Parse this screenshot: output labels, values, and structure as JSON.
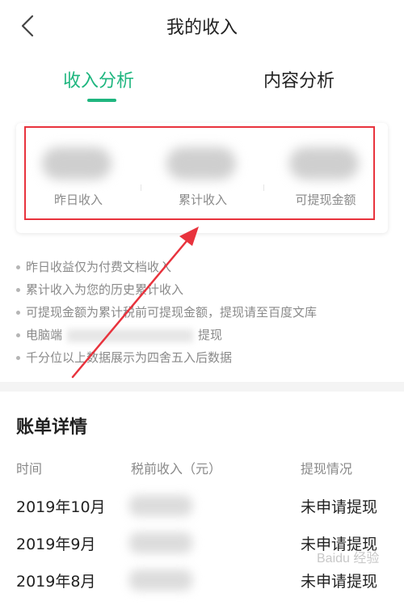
{
  "header": {
    "title": "我的收入"
  },
  "tabs": [
    {
      "label": "收入分析",
      "active": true
    },
    {
      "label": "内容分析",
      "active": false
    }
  ],
  "summary": {
    "items": [
      {
        "label": "昨日收入"
      },
      {
        "label": "累计收入"
      },
      {
        "label": "可提现金额"
      }
    ]
  },
  "notes": [
    "昨日收益仅为付费文档收入",
    "累计收入为您的历史累计收入",
    "可提现金额为累计税前可提现金额，提现请至百度文库",
    "电脑端",
    "提现",
    "千分位以上数据展示为四舍五入后数据"
  ],
  "bill": {
    "title": "账单详情",
    "columns": [
      "时间",
      "税前收入（元）",
      "提现情况"
    ],
    "rows": [
      {
        "date": "2019年10月",
        "status": "未申请提现"
      },
      {
        "date": "2019年9月",
        "status": "未申请提现"
      },
      {
        "date": "2019年8月",
        "status": "未申请提现"
      }
    ]
  },
  "watermark": "Baidu 经验",
  "colors": {
    "accent": "#1fb67f",
    "annotation": "#e8333d"
  },
  "icons": {
    "back": "chevron-left-icon"
  }
}
